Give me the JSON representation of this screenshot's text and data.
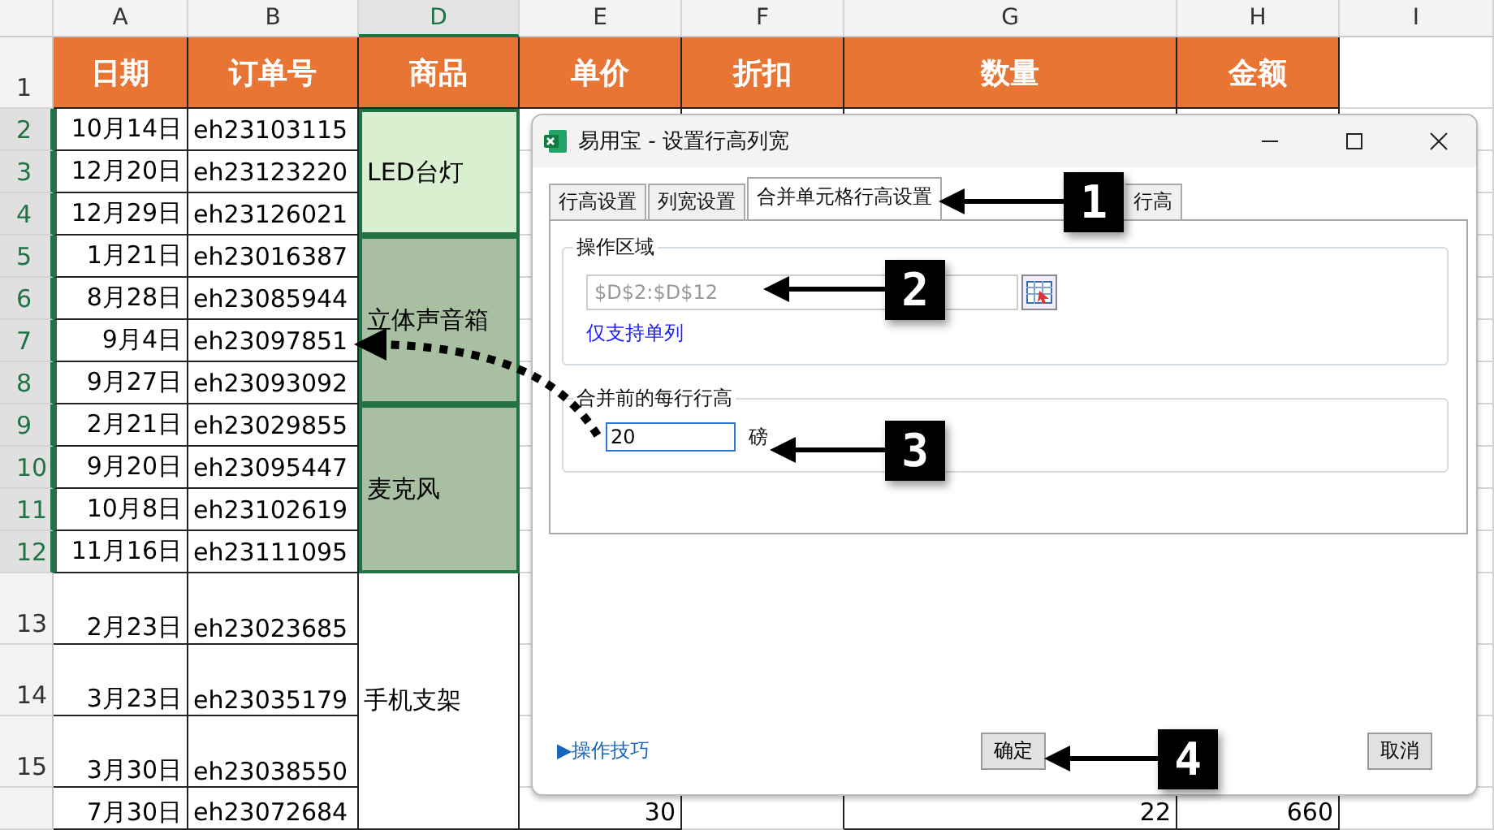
{
  "sheet": {
    "columns": [
      {
        "label": "A",
        "selected": false
      },
      {
        "label": "B",
        "selected": false
      },
      {
        "label": "D",
        "selected": true
      },
      {
        "label": "E",
        "selected": false
      },
      {
        "label": "F",
        "selected": false
      },
      {
        "label": "G",
        "selected": false
      },
      {
        "label": "H",
        "selected": false
      },
      {
        "label": "I",
        "selected": false
      }
    ],
    "header_row_num": "1",
    "headers": [
      "日期",
      "订单号",
      "商品",
      "单价",
      "折扣",
      "数量",
      "金额"
    ],
    "rows": [
      {
        "num": "2",
        "selected": true,
        "date": "10月14日",
        "order": "eh23103115"
      },
      {
        "num": "3",
        "selected": true,
        "date": "12月20日",
        "order": "eh23123220"
      },
      {
        "num": "4",
        "selected": true,
        "date": "12月29日",
        "order": "eh23126021"
      },
      {
        "num": "5",
        "selected": true,
        "date": "1月21日",
        "order": "eh23016387"
      },
      {
        "num": "6",
        "selected": true,
        "date": "8月28日",
        "order": "eh23085944"
      },
      {
        "num": "7",
        "selected": true,
        "date": "9月4日",
        "order": "eh23097851"
      },
      {
        "num": "8",
        "selected": true,
        "date": "9月27日",
        "order": "eh23093092"
      },
      {
        "num": "9",
        "selected": true,
        "date": "2月21日",
        "order": "eh23029855"
      },
      {
        "num": "10",
        "selected": true,
        "date": "9月20日",
        "order": "eh23095447"
      },
      {
        "num": "11",
        "selected": true,
        "date": "10月8日",
        "order": "eh23102619"
      },
      {
        "num": "12",
        "selected": true,
        "date": "11月16日",
        "order": "eh23111095"
      },
      {
        "num": "13",
        "selected": false,
        "date": "2月23日",
        "order": "eh23023685"
      },
      {
        "num": "14",
        "selected": false,
        "date": "3月23日",
        "order": "eh23035179"
      },
      {
        "num": "15",
        "selected": false,
        "date": "3月30日",
        "order": "eh23038550"
      },
      {
        "selected": false,
        "date": "7月30日",
        "order": "eh23072684",
        "price": "30",
        "qty": "22",
        "amount": "660"
      }
    ],
    "products": [
      {
        "name": "LED台灯",
        "color": "#d9f0d0"
      },
      {
        "name": "立体声音箱",
        "color": "#a9bfa1"
      },
      {
        "name": "麦克风",
        "color": "#a9bfa1"
      },
      {
        "name": "手机支架",
        "color": "#ffffff"
      }
    ]
  },
  "dialog": {
    "title": "易用宝 - 设置行高列宽",
    "tabs": [
      {
        "label": "行高设置",
        "selected": false
      },
      {
        "label": "列宽设置",
        "selected": false
      },
      {
        "label": "合并单元格行高设置",
        "selected": true
      },
      {
        "label": "行高",
        "selected": false
      }
    ],
    "range_group": {
      "legend": "操作区域",
      "value": "$D$2:$D$12",
      "note": "仅支持单列"
    },
    "height_group": {
      "legend": "合并前的每行行高",
      "value": "20",
      "unit": "磅"
    },
    "tips_link": "▶操作技巧",
    "buttons": [
      "确定",
      "取消"
    ]
  },
  "callouts": [
    "1",
    "2",
    "3",
    "4"
  ]
}
